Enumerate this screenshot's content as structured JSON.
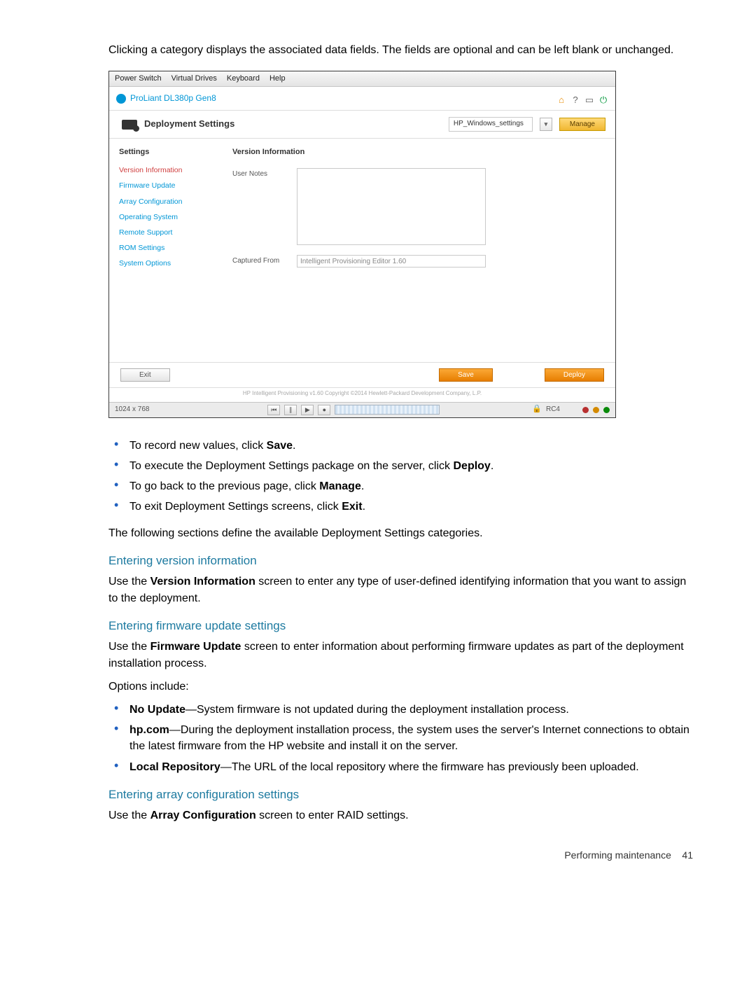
{
  "intro": "Clicking a category displays the associated data fields. The fields are optional and can be left blank or unchanged.",
  "titlebar": {
    "items": [
      "Power Switch",
      "Virtual Drives",
      "Keyboard",
      "Help"
    ]
  },
  "appHeader": {
    "title": "ProLiant DL380p Gen8"
  },
  "toolbar": {
    "title": "Deployment Settings",
    "profile": "HP_Windows_settings",
    "manage": "Manage"
  },
  "sidebar": {
    "title": "Settings",
    "items": [
      {
        "label": "Version Information",
        "active": true
      },
      {
        "label": "Firmware Update",
        "active": false
      },
      {
        "label": "Array Configuration",
        "active": false
      },
      {
        "label": "Operating System",
        "active": false
      },
      {
        "label": "Remote Support",
        "active": false
      },
      {
        "label": "ROM Settings",
        "active": false
      },
      {
        "label": "System Options",
        "active": false
      }
    ]
  },
  "main": {
    "title": "Version Information",
    "userNotesLabel": "User Notes",
    "capturedFromLabel": "Captured From",
    "capturedFromValue": "Intelligent Provisioning Editor 1.60"
  },
  "footer": {
    "exit": "Exit",
    "save": "Save",
    "deploy": "Deploy"
  },
  "copyright": "HP Intelligent Provisioning v1.60 Copyright ©2014 Hewlett-Packard Development Company, L.P.",
  "statusbar": {
    "res": "1024 x 768",
    "enc": "RC4"
  },
  "bullets1": [
    {
      "pre": "To record new values, click ",
      "strong": "Save",
      "post": "."
    },
    {
      "pre": "To execute the Deployment Settings package on the server, click ",
      "strong": "Deploy",
      "post": "."
    },
    {
      "pre": "To go back to the previous page, click ",
      "strong": "Manage",
      "post": "."
    },
    {
      "pre": "To exit Deployment Settings screens, click ",
      "strong": "Exit",
      "post": "."
    }
  ],
  "following": "The following sections define the available Deployment Settings categories.",
  "sec1": {
    "h": "Entering version information",
    "body_pre": "Use the ",
    "body_strong": "Version Information",
    "body_post": " screen to enter any type of user-defined identifying information that you want to assign to the deployment."
  },
  "sec2": {
    "h": "Entering firmware update settings",
    "body_pre": "Use the ",
    "body_strong": "Firmware Update",
    "body_post": " screen to enter information about performing firmware updates as part of the deployment installation process.",
    "options": "Options include:",
    "opts": [
      {
        "strong": "No Update",
        "rest": "—System firmware is not updated during the deployment installation process."
      },
      {
        "strong": "hp.com",
        "rest": "—During the deployment installation process, the system uses the server's Internet connections to obtain the latest firmware from the HP website and install it on the server."
      },
      {
        "strong": "Local Repository",
        "rest": "—The URL of the local repository where the firmware has previously been uploaded."
      }
    ]
  },
  "sec3": {
    "h": "Entering array configuration settings",
    "body_pre": "Use the ",
    "body_strong": "Array Configuration",
    "body_post": " screen to enter RAID settings."
  },
  "pageFoot": {
    "label": "Performing maintenance",
    "num": "41"
  }
}
